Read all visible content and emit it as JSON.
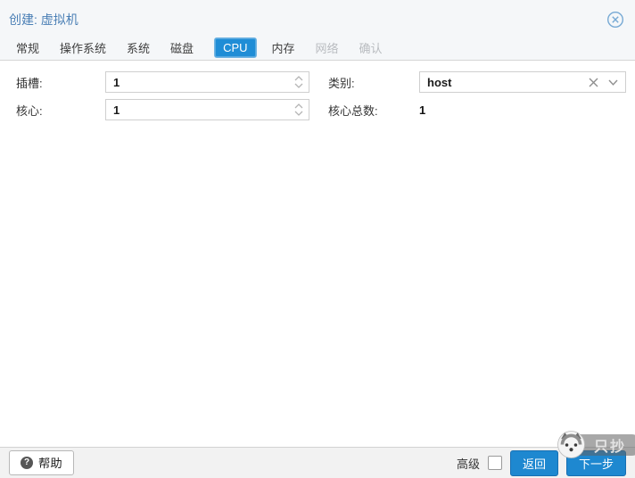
{
  "dialog": {
    "title": "创建: 虚拟机"
  },
  "tabs": [
    {
      "label": "常规",
      "state": "normal"
    },
    {
      "label": "操作系统",
      "state": "normal"
    },
    {
      "label": "系统",
      "state": "normal"
    },
    {
      "label": "磁盘",
      "state": "normal"
    },
    {
      "label": "CPU",
      "state": "active"
    },
    {
      "label": "内存",
      "state": "normal"
    },
    {
      "label": "网络",
      "state": "disabled"
    },
    {
      "label": "确认",
      "state": "disabled"
    }
  ],
  "form": {
    "sockets": {
      "label": "插槽:",
      "value": "1"
    },
    "cores": {
      "label": "核心:",
      "value": "1"
    },
    "type": {
      "label": "类别:",
      "value": "host"
    },
    "total_cores": {
      "label": "核心总数:",
      "value": "1"
    }
  },
  "footer": {
    "help_label": "帮助",
    "help_glyph": "?",
    "advanced_label": "高级",
    "advanced_checked": false,
    "back_label": "返回",
    "next_label": "下一步"
  },
  "watermark": {
    "text": "只抄"
  },
  "icons": {
    "close": "circle-x",
    "help": "question-circle",
    "spinner": "chevron-up-down",
    "combo_clear": "x",
    "combo_expand": "chevron-down",
    "watermark_logo": "husky-face"
  },
  "colors": {
    "accent_blue": "#1e88d0",
    "active_tab_blue": "#1f8dd6",
    "title_blue": "#4a7fb5",
    "header_bg": "#f5f7f9",
    "footer_bg": "#f2f2f2",
    "disabled_text": "#b9bcc0"
  }
}
